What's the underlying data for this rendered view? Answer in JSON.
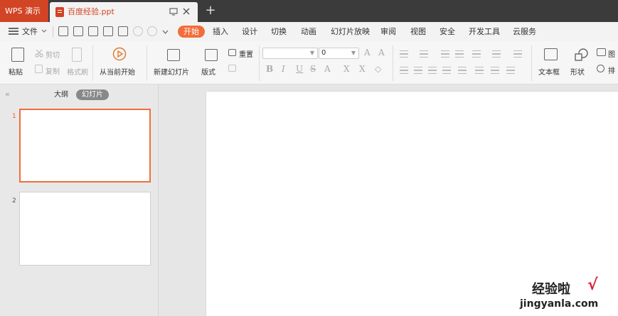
{
  "titlebar": {
    "app_name": "WPS 演示",
    "doc_title": "百度经验.ppt",
    "restore_icon": "restore-window-icon",
    "close_icon": "close-icon",
    "new_tab": "+"
  },
  "menubar": {
    "file": "文件",
    "tabs": [
      "开始",
      "插入",
      "设计",
      "切换",
      "动画",
      "幻灯片放映",
      "审阅",
      "视图",
      "安全",
      "开发工具",
      "云服务"
    ],
    "active_tab": "开始"
  },
  "ribbon": {
    "paste": "粘贴",
    "cut": "剪切",
    "copy": "复制",
    "format_painter": "格式刷",
    "play_from_current": "从当前开始",
    "new_slide": "新建幻灯片",
    "layout": "版式",
    "reset": "重置",
    "font_size_value": "0",
    "text_box": "文本框",
    "shapes": "形状",
    "picture": "图",
    "arrange": "排"
  },
  "left_panel": {
    "tabs": [
      "大纲",
      "幻灯片"
    ],
    "active_tab": "幻灯片",
    "slide_numbers": [
      "1",
      "2"
    ]
  },
  "watermark": {
    "line1": "经验啦",
    "check": "√",
    "line2": "jingyanla.com"
  },
  "colors": {
    "accent": "#f26d3b",
    "app_tab": "#d14424",
    "titlebar": "#3b3b3b"
  }
}
